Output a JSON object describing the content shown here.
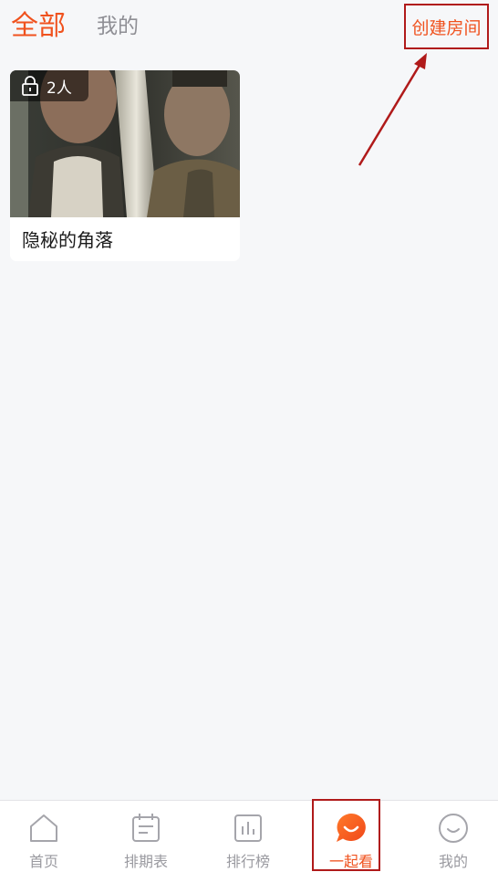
{
  "header": {
    "tabs": [
      {
        "label": "全部",
        "active": true
      },
      {
        "label": "我的",
        "active": false
      }
    ],
    "create_room_label": "创建房间"
  },
  "rooms": [
    {
      "title": "隐秘的角落",
      "member_count_label": "2人",
      "locked": true,
      "badge_icon": "lock-icon"
    }
  ],
  "bottom_nav": {
    "items": [
      {
        "label": "首页",
        "icon": "home-icon",
        "active": false
      },
      {
        "label": "排期表",
        "icon": "calendar-icon",
        "active": false
      },
      {
        "label": "排行榜",
        "icon": "bar-chart-icon",
        "active": false
      },
      {
        "label": "一起看",
        "icon": "chat-bubble-icon",
        "active": true
      },
      {
        "label": "我的",
        "icon": "smiley-icon",
        "active": false
      }
    ]
  },
  "colors": {
    "accent": "#f0521e",
    "inactive": "#9a9aa0",
    "background": "#f6f7f9",
    "annotation": "#b01a1a"
  }
}
